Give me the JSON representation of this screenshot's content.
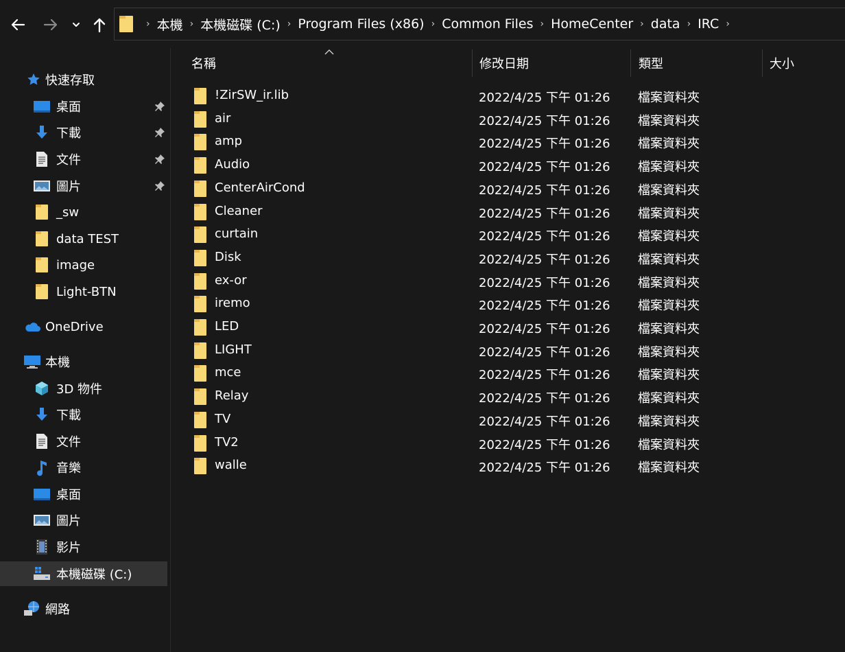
{
  "toolbar": {
    "back_icon": "arrow-left-icon",
    "forward_icon": "arrow-right-icon",
    "recent_icon": "chevron-down-icon",
    "up_icon": "arrow-up-icon"
  },
  "address": {
    "crumbs": [
      "本機",
      "本機磁碟 (C:)",
      "Program Files (x86)",
      "Common Files",
      "HomeCenter",
      "data",
      "IRC"
    ]
  },
  "sidebar": {
    "quick_access": "快速存取",
    "pinned": [
      "桌面",
      "下載",
      "文件",
      "圖片"
    ],
    "folders": [
      "_sw",
      "data TEST",
      "image",
      "Light-BTN"
    ],
    "onedrive": "OneDrive",
    "this_pc": "本機",
    "pc_items": [
      "3D 物件",
      "下載",
      "文件",
      "音樂",
      "桌面",
      "圖片",
      "影片",
      "本機磁碟 (C:)"
    ],
    "network": "網路"
  },
  "columns": {
    "name": "名稱",
    "date": "修改日期",
    "type": "類型",
    "size": "大小"
  },
  "files": [
    {
      "name": "!ZirSW_ir.lib",
      "date": "2022/4/25 下午 01:26",
      "type": "檔案資料夾"
    },
    {
      "name": "air",
      "date": "2022/4/25 下午 01:26",
      "type": "檔案資料夾"
    },
    {
      "name": "amp",
      "date": "2022/4/25 下午 01:26",
      "type": "檔案資料夾"
    },
    {
      "name": "Audio",
      "date": "2022/4/25 下午 01:26",
      "type": "檔案資料夾"
    },
    {
      "name": "CenterAirCond",
      "date": "2022/4/25 下午 01:26",
      "type": "檔案資料夾"
    },
    {
      "name": "Cleaner",
      "date": "2022/4/25 下午 01:26",
      "type": "檔案資料夾"
    },
    {
      "name": "curtain",
      "date": "2022/4/25 下午 01:26",
      "type": "檔案資料夾"
    },
    {
      "name": "Disk",
      "date": "2022/4/25 下午 01:26",
      "type": "檔案資料夾"
    },
    {
      "name": "ex-or",
      "date": "2022/4/25 下午 01:26",
      "type": "檔案資料夾"
    },
    {
      "name": "iremo",
      "date": "2022/4/25 下午 01:26",
      "type": "檔案資料夾"
    },
    {
      "name": "LED",
      "date": "2022/4/25 下午 01:26",
      "type": "檔案資料夾"
    },
    {
      "name": "LIGHT",
      "date": "2022/4/25 下午 01:26",
      "type": "檔案資料夾"
    },
    {
      "name": "mce",
      "date": "2022/4/25 下午 01:26",
      "type": "檔案資料夾"
    },
    {
      "name": "Relay",
      "date": "2022/4/25 下午 01:26",
      "type": "檔案資料夾"
    },
    {
      "name": "TV",
      "date": "2022/4/25 下午 01:26",
      "type": "檔案資料夾"
    },
    {
      "name": "TV2",
      "date": "2022/4/25 下午 01:26",
      "type": "檔案資料夾"
    },
    {
      "name": "walle",
      "date": "2022/4/25 下午 01:26",
      "type": "檔案資料夾"
    }
  ],
  "colors": {
    "background": "#191919",
    "folder": "#F8D775",
    "selected": "#333333",
    "accent": "#3A8EE6"
  }
}
